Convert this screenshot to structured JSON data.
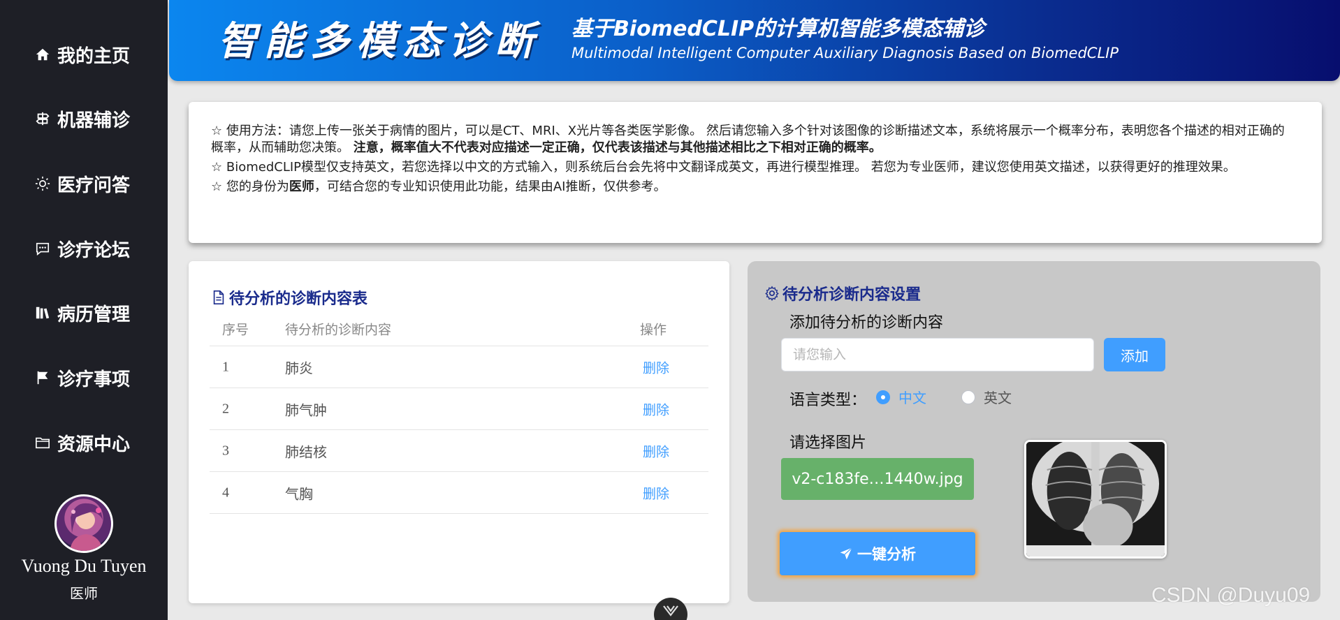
{
  "sidebar": {
    "items": [
      {
        "label": "我的主页",
        "icon": "home-icon"
      },
      {
        "label": "机器辅诊",
        "icon": "signpost-icon"
      },
      {
        "label": "医疗问答",
        "icon": "sun-icon"
      },
      {
        "label": "诊疗论坛",
        "icon": "chat-icon"
      },
      {
        "label": "病历管理",
        "icon": "books-icon"
      },
      {
        "label": "诊疗事项",
        "icon": "flag-icon"
      },
      {
        "label": "资源中心",
        "icon": "folder-icon"
      }
    ],
    "user": {
      "name": "Vuong Du Tuyen",
      "role": "医师"
    }
  },
  "header": {
    "logo": "智能多模态诊断",
    "title_cn": "基于BiomedCLIP的计算机智能多模态辅诊",
    "title_en": "Multimodal Intelligent Computer Auxiliary Diagnosis Based on BiomedCLIP"
  },
  "instructions": {
    "line1_a": "☆ 使用方法：请您上传一张关于病情的图片，可以是CT、MRI、X光片等各类医学影像。 然后请您输入多个针对该图像的诊断描述文本，系统将展示一个概率分布，表明您各个描述的相对正确的概率，从而辅助您决策。 ",
    "line1_bold": "注意，概率值大不代表对应描述一定正确，仅代表该描述与其他描述相比之下相对正确的概率。",
    "line2": "☆ BiomedCLIP模型仅支持英文，若您选择以中文的方式输入，则系统后台会先将中文翻译成英文，再进行模型推理。 若您为专业医师，建议您使用英文描述，以获得更好的推理效果。",
    "line3_a": "☆ 您的身份为",
    "line3_bold": "医师",
    "line3_b": "，可结合您的专业知识使用此功能，结果由AI推断，仅供参考。"
  },
  "table": {
    "title": "待分析的诊断内容表",
    "columns": [
      "序号",
      "待分析的诊断内容",
      "操作"
    ],
    "rows": [
      {
        "index": "1",
        "content": "肺炎",
        "action": "删除"
      },
      {
        "index": "2",
        "content": "肺气肿",
        "action": "删除"
      },
      {
        "index": "3",
        "content": "肺结核",
        "action": "删除"
      },
      {
        "index": "4",
        "content": "气胸",
        "action": "删除"
      }
    ]
  },
  "settings": {
    "title": "待分析诊断内容设置",
    "add_label": "添加待分析的诊断内容",
    "input_placeholder": "请您输入",
    "input_value": "",
    "add_button": "添加",
    "language_label": "语言类型：",
    "language_options": [
      "中文",
      "英文"
    ],
    "language_selected": "中文",
    "image_label": "请选择图片",
    "file_name": "v2-c183fe…1440w.jpg",
    "analyze_button": "一键分析"
  },
  "watermark": "CSDN @Duyu09",
  "colors": {
    "sidebar_bg": "#1e1f26",
    "accent": "#409eff",
    "file_button": "#67b16a",
    "card_title": "#1a2b8c",
    "settings_bg": "#c8c8c8"
  }
}
